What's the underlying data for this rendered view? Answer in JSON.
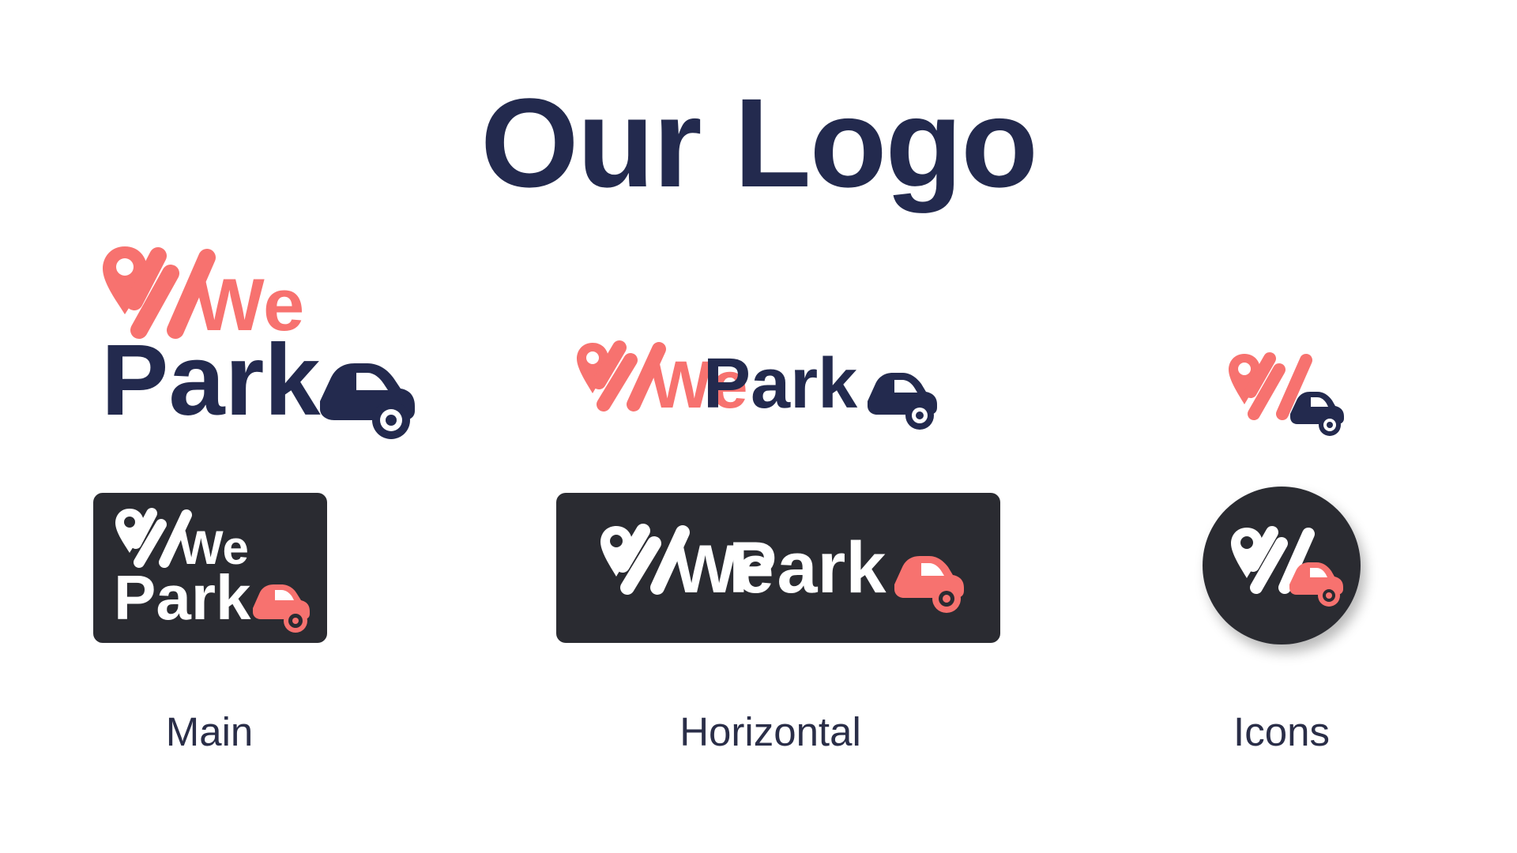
{
  "page": {
    "title": "Our Logo",
    "labels": {
      "main": "Main",
      "horizontal": "Horizontal",
      "icons": "Icons"
    }
  },
  "brand": {
    "wordmark_we": "We",
    "wordmark_park": "Park",
    "wordmark_full_we": "We",
    "wordmark_full_park": "Park"
  },
  "colors": {
    "navy": "#232a4e",
    "coral": "#f7726f",
    "dark_panel": "#2a2b31",
    "white": "#ffffff",
    "label_text": "#2a2e48"
  },
  "icons": [
    "map-pin-icon",
    "car-icon"
  ]
}
